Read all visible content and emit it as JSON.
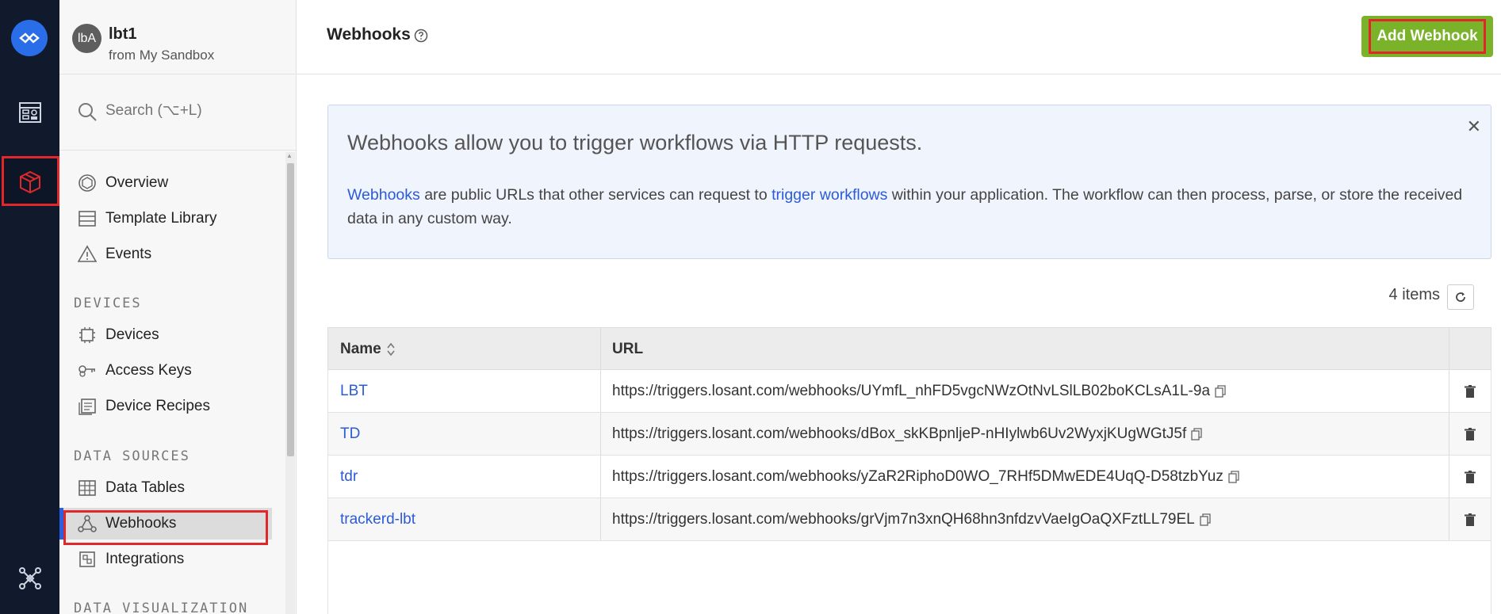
{
  "sidebar": {
    "avatar_text": "lbA",
    "app_name": "lbt1",
    "app_sub": "from My Sandbox",
    "search_placeholder": "Search (⌥+L)",
    "items": [
      {
        "label": "Overview"
      },
      {
        "label": "Template Library"
      },
      {
        "label": "Events"
      },
      {
        "label": "Devices"
      },
      {
        "label": "Access Keys"
      },
      {
        "label": "Device Recipes"
      },
      {
        "label": "Data Tables"
      },
      {
        "label": "Webhooks"
      },
      {
        "label": "Integrations"
      }
    ],
    "sections": [
      "DEVICES",
      "DATA SOURCES",
      "DATA VISUALIZATION"
    ]
  },
  "markers": [
    "1",
    "2",
    "3"
  ],
  "header": {
    "title": "Webhooks",
    "add_button": "Add Webhook"
  },
  "banner": {
    "heading": "Webhooks allow you to trigger workflows via HTTP requests.",
    "link1": "Webhooks",
    "text1": " are public URLs that other services can request to ",
    "link2": "trigger workflows",
    "text2": " within your application. The workflow can then process, parse, or store the received data in any custom way."
  },
  "items_count": "4 items",
  "table": {
    "columns": [
      "Name",
      "URL"
    ],
    "rows": [
      {
        "name": "LBT",
        "url": "https://triggers.losant.com/webhooks/UYmfL_nhFD5vgcNWzOtNvLSlLB02boKCLsA1L-9a"
      },
      {
        "name": "TD",
        "url": "https://triggers.losant.com/webhooks/dBox_skKBpnljeP-nHIylwb6Uv2WyxjKUgWGtJ5f"
      },
      {
        "name": "tdr",
        "url": "https://triggers.losant.com/webhooks/yZaR2RiphoD0WO_7RHf5DMwEDE4UqQ-D58tzbYuz"
      },
      {
        "name": "trackerd-lbt",
        "url": "https://triggers.losant.com/webhooks/grVjm7n3xnQH68hn3nfdzvVaeIgOaQXFztLL79EL"
      }
    ]
  },
  "colors": {
    "rail": "#101a2c",
    "accent_blue": "#2a6de8",
    "link": "#2c5bd8",
    "primary_button": "#7ab22a",
    "highlight": "#e0282a"
  }
}
